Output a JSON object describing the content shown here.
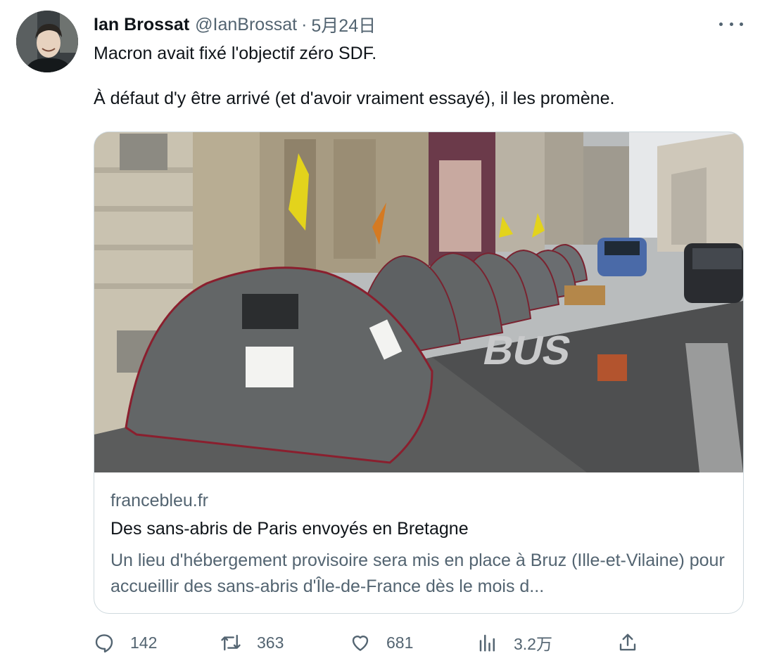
{
  "author": {
    "display_name": "Ian Brossat",
    "handle": "@IanBrossat",
    "separator": "·",
    "date": "5月24日"
  },
  "tweet": {
    "line1": "Macron avait fixé l'objectif zéro SDF.",
    "line2": "À défaut d'y être arrivé (et d'avoir vraiment essayé), il les promène."
  },
  "card": {
    "domain": "francebleu.fr",
    "title": "Des sans-abris de Paris envoyés en Bretagne",
    "description": "Un lieu d'hébergement provisoire sera mis en place à Bruz (Ille-et-Vilaine) pour accueillir des sans-abris d'Île-de-France dès le mois d...",
    "image_road_text": "BUS"
  },
  "actions": {
    "replies": "142",
    "retweets": "363",
    "likes": "681",
    "views": "3.2万"
  },
  "icons": {
    "reply": "reply-icon",
    "retweet": "retweet-icon",
    "like": "like-icon",
    "views": "views-icon",
    "share": "share-icon",
    "more": "more-icon"
  },
  "colors": {
    "text_primary": "#0f1419",
    "text_secondary": "#536471",
    "border": "#cfd9de"
  }
}
